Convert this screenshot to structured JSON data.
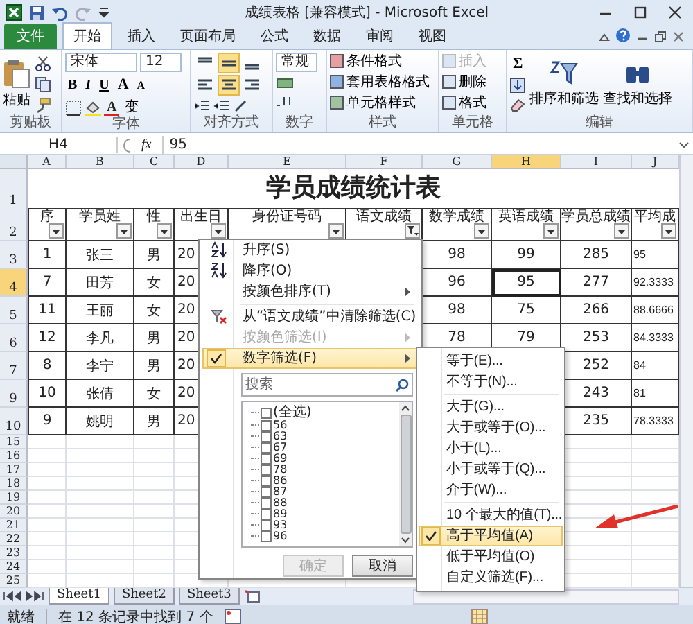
{
  "window": {
    "title": "成绩表格  [兼容模式]  - Microsoft Excel"
  },
  "ribbon_tabs": [
    {
      "label": "文件",
      "kind": "file",
      "selected": false
    },
    {
      "label": "开始",
      "kind": "tab",
      "selected": true
    },
    {
      "label": "插入",
      "kind": "tab",
      "selected": false
    },
    {
      "label": "页面布局",
      "kind": "tab",
      "selected": false
    },
    {
      "label": "公式",
      "kind": "tab",
      "selected": false
    },
    {
      "label": "数据",
      "kind": "tab",
      "selected": false
    },
    {
      "label": "审阅",
      "kind": "tab",
      "selected": false
    },
    {
      "label": "视图",
      "kind": "tab",
      "selected": false
    }
  ],
  "ribbon": {
    "clipboard": {
      "label": "剪贴板",
      "paste": "粘贴"
    },
    "font": {
      "label": "字体",
      "font": "宋体",
      "size": "12",
      "buttons": [
        "B",
        "I",
        "U"
      ],
      "grow": "A",
      "shrink": "A",
      "font_color": "A",
      "phonetic": "变"
    },
    "alignment": {
      "label": "对齐方式",
      "buttons": [
        {
          "selected": false
        },
        {
          "selected": true
        },
        {
          "selected": false
        },
        {
          "selected": false
        },
        {
          "selected": true
        },
        {
          "selected": false
        }
      ]
    },
    "number": {
      "label": "数字",
      "format": "常规"
    },
    "styles": {
      "label": "样式",
      "commands": [
        "条件格式",
        "套用表格格式",
        "单元格样式"
      ]
    },
    "cells": {
      "label": "单元格",
      "commands": [
        {
          "label": "插入",
          "disabled": true
        },
        {
          "label": "删除",
          "disabled": false
        },
        {
          "label": "格式",
          "disabled": false
        }
      ]
    },
    "editing": {
      "label": "编辑",
      "sum": "Σ",
      "commands": [
        "排序和筛选",
        "查找和选择"
      ]
    }
  },
  "formula_bar": {
    "name_box": "H4",
    "fx": "fx",
    "value": "95"
  },
  "sheet": {
    "columns": [
      {
        "label": "A",
        "selected": false
      },
      {
        "label": "B",
        "selected": false
      },
      {
        "label": "C",
        "selected": false
      },
      {
        "label": "D",
        "selected": false
      },
      {
        "label": "E",
        "selected": false
      },
      {
        "label": "F",
        "selected": false
      },
      {
        "label": "G",
        "selected": false
      },
      {
        "label": "H",
        "selected": true
      },
      {
        "label": "I",
        "selected": false
      },
      {
        "label": "J",
        "selected": false
      }
    ],
    "title_row": {
      "num": "1",
      "title": "学员成绩统计表"
    },
    "header_row": {
      "num": "2",
      "headers": [
        {
          "text": "序",
          "filtered": false
        },
        {
          "text": "学员姓",
          "filtered": false
        },
        {
          "text": "性",
          "filtered": false
        },
        {
          "text": "出生日",
          "filtered": false
        },
        {
          "text": "身份证号码",
          "filtered": false
        },
        {
          "text": "语文成绩",
          "filtered": true
        },
        {
          "text": "数学成绩",
          "filtered": false
        },
        {
          "text": "英语成绩",
          "filtered": false
        },
        {
          "text": "学员总成绩",
          "filtered": false
        },
        {
          "text": "平均成",
          "filtered": false
        }
      ]
    },
    "rows": [
      {
        "num": "3",
        "selected": false,
        "seq": "1",
        "name": "张三",
        "gender": "男",
        "birth": "20",
        "math": "98",
        "english": "99",
        "total": "285",
        "average": "95"
      },
      {
        "num": "4",
        "selected": true,
        "seq": "7",
        "name": "田芳",
        "gender": "女",
        "birth": "20",
        "math": "96",
        "english": "95",
        "total": "277",
        "average": "92.3333"
      },
      {
        "num": "5",
        "selected": false,
        "seq": "11",
        "name": "王丽",
        "gender": "女",
        "birth": "20",
        "math": "98",
        "english": "75",
        "total": "266",
        "average": "88.6666"
      },
      {
        "num": "6",
        "selected": false,
        "seq": "12",
        "name": "李凡",
        "gender": "男",
        "birth": "20",
        "math": "78",
        "english": "79",
        "total": "253",
        "average": "84.3333"
      },
      {
        "num": "7",
        "selected": false,
        "seq": "8",
        "name": "李宁",
        "gender": "男",
        "birth": "20",
        "total": "252",
        "average": "84"
      },
      {
        "num": "9",
        "selected": false,
        "seq": "10",
        "name": "张倩",
        "gender": "女",
        "birth": "20",
        "total": "243",
        "average": "81"
      },
      {
        "num": "10",
        "selected": false,
        "seq": "9",
        "name": "姚明",
        "gender": "男",
        "birth": "20",
        "total": "235",
        "average": "78.3333"
      }
    ],
    "empty_rows": [
      "15",
      "16",
      "17",
      "18",
      "19",
      "20",
      "21",
      "22",
      "23",
      "24",
      "25"
    ],
    "sheet_tabs": [
      {
        "label": "Sheet1",
        "selected": true
      },
      {
        "label": "Sheet2",
        "selected": false
      },
      {
        "label": "Sheet3",
        "selected": false
      }
    ]
  },
  "filter_menu": {
    "items": [
      {
        "label": "升序(S)",
        "disabled": false,
        "checked": false,
        "submenu": false,
        "separator_after": false
      },
      {
        "label": "降序(O)",
        "disabled": false,
        "checked": false,
        "submenu": false,
        "separator_after": false
      },
      {
        "label": "按颜色排序(T)",
        "disabled": false,
        "checked": false,
        "submenu": true,
        "separator_after": true
      },
      {
        "label": "从“语文成绩”中清除筛选(C)",
        "disabled": false,
        "checked": false,
        "submenu": false,
        "separator_after": false
      },
      {
        "label": "按颜色筛选(I)",
        "disabled": true,
        "checked": false,
        "submenu": true,
        "separator_after": false
      },
      {
        "label": "数字筛选(F)",
        "disabled": false,
        "checked": true,
        "submenu": true,
        "separator_after": false
      }
    ],
    "search": {
      "placeholder": "搜索"
    },
    "values": [
      {
        "label": "(全选)",
        "checked": false
      },
      {
        "label": "56",
        "checked": false
      },
      {
        "label": "63",
        "checked": false
      },
      {
        "label": "67",
        "checked": false
      },
      {
        "label": "69",
        "checked": false
      },
      {
        "label": "78",
        "checked": false
      },
      {
        "label": "86",
        "checked": false
      },
      {
        "label": "87",
        "checked": false
      },
      {
        "label": "88",
        "checked": false
      },
      {
        "label": "89",
        "checked": false
      },
      {
        "label": "93",
        "checked": false
      },
      {
        "label": "96",
        "checked": false
      }
    ],
    "ok": {
      "label": "确定",
      "disabled": true
    },
    "cancel": {
      "label": "取消",
      "disabled": false
    }
  },
  "number_filter_menu": {
    "items": [
      {
        "label": "等于(E)...",
        "checked": false,
        "separator_after": false
      },
      {
        "label": "不等于(N)...",
        "checked": false,
        "separator_after": true
      },
      {
        "label": "大于(G)...",
        "checked": false,
        "separator_after": false
      },
      {
        "label": "大于或等于(O)...",
        "checked": false,
        "separator_after": false
      },
      {
        "label": "小于(L)...",
        "checked": false,
        "separator_after": false
      },
      {
        "label": "小于或等于(Q)...",
        "checked": false,
        "separator_after": false
      },
      {
        "label": "介于(W)...",
        "checked": false,
        "separator_after": true
      },
      {
        "label": "10 个最大的值(T)...",
        "checked": false,
        "separator_after": false
      },
      {
        "label": "高于平均值(A)",
        "checked": true,
        "separator_after": false
      },
      {
        "label": "低于平均值(O)",
        "checked": false,
        "separator_after": false
      },
      {
        "label": "自定义筛选(F)...",
        "checked": false,
        "separator_after": false
      }
    ]
  },
  "status_bar": {
    "state": "就绪",
    "message": "在 12 条记录中找到 7 个"
  }
}
